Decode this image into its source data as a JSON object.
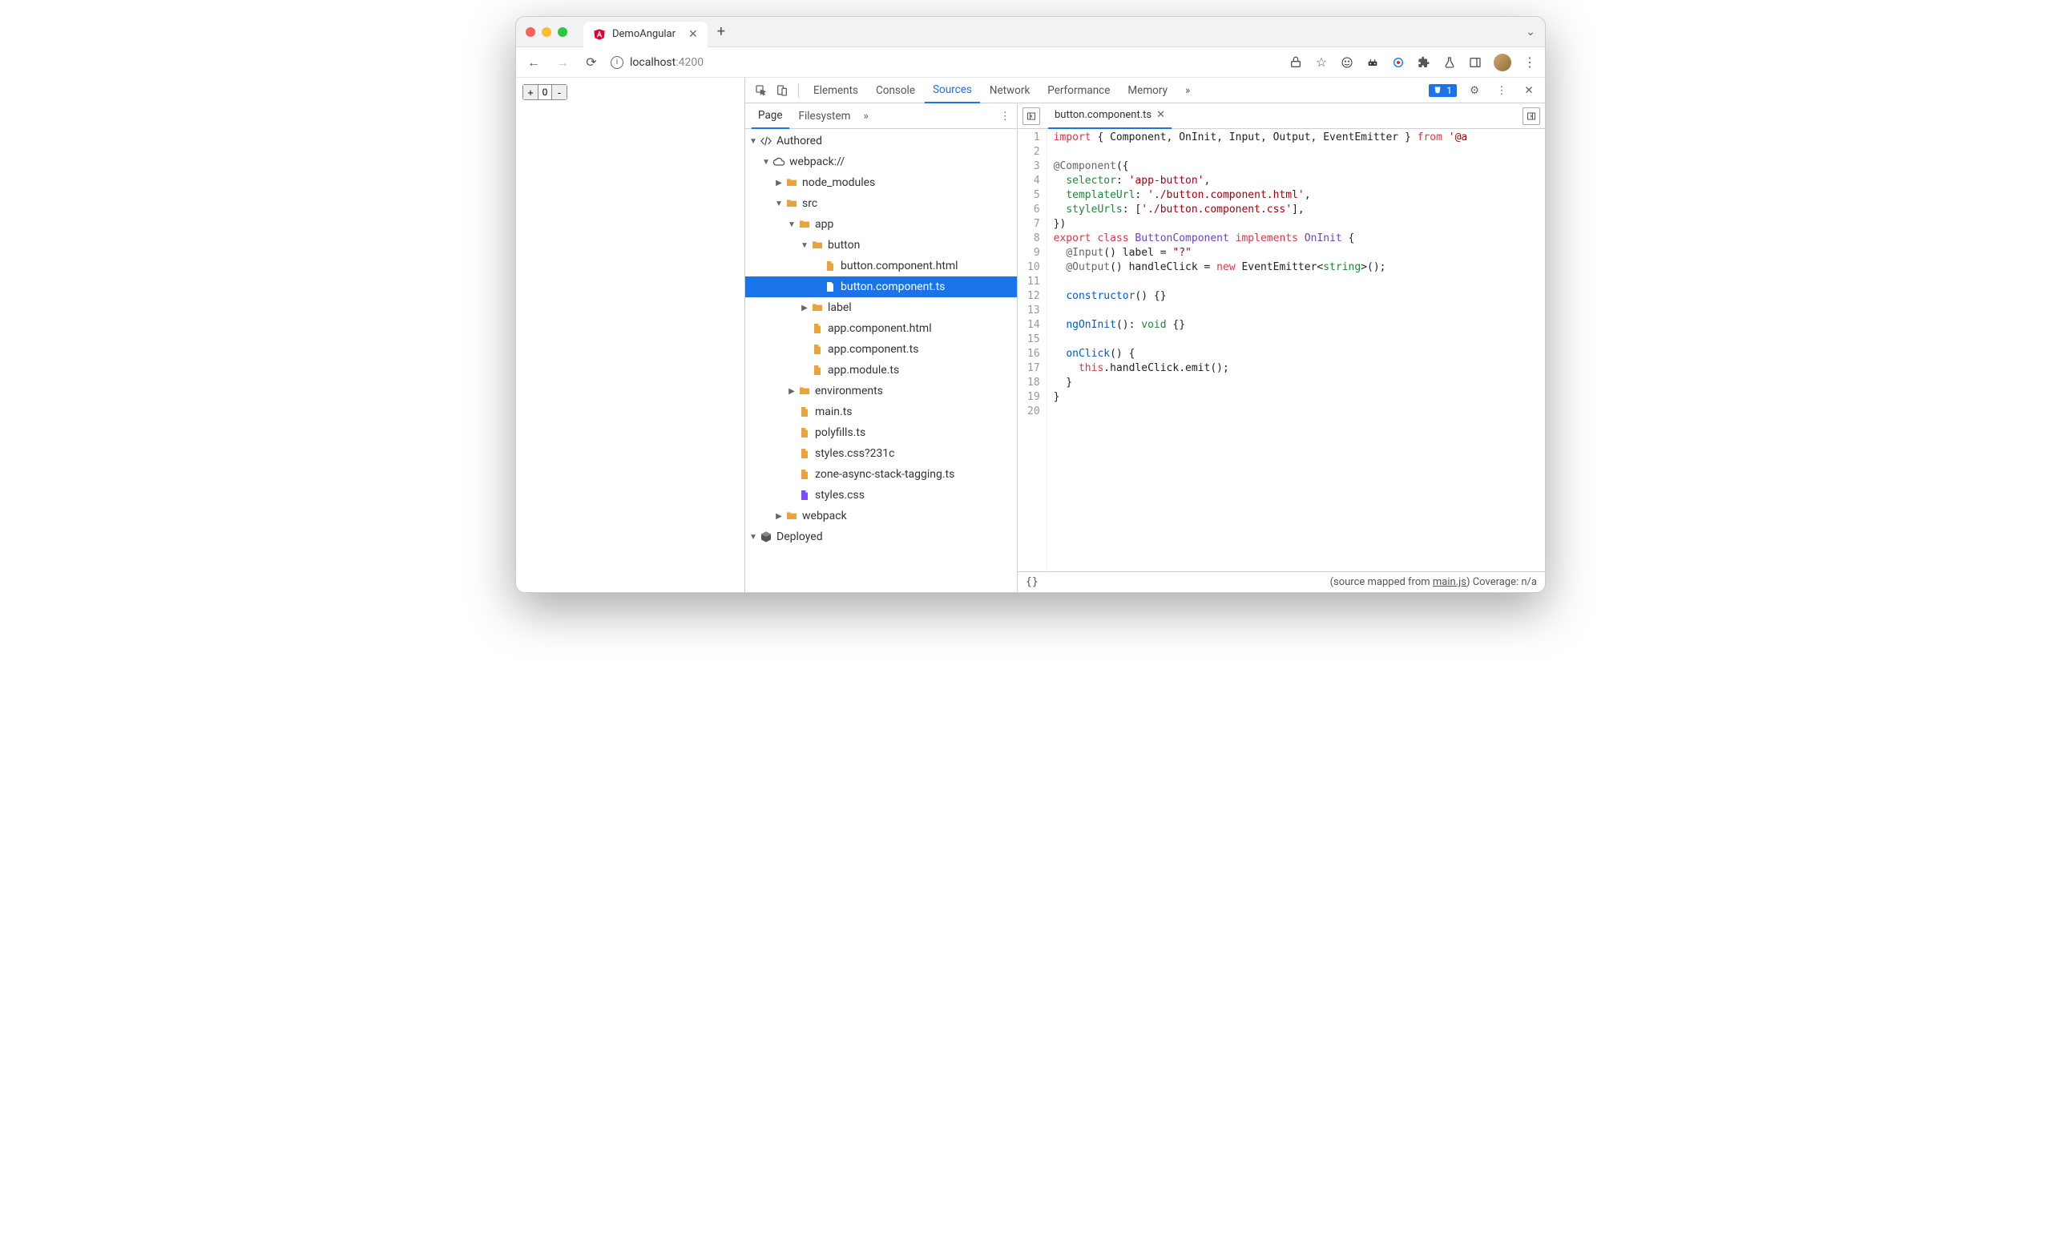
{
  "browser": {
    "tab_title": "DemoAngular",
    "url_host": "localhost",
    "url_port": ":4200"
  },
  "page_app": {
    "counter_value": "0",
    "plus": "+",
    "minus": "-"
  },
  "devtools": {
    "tabs": [
      "Elements",
      "Console",
      "Sources",
      "Network",
      "Performance",
      "Memory"
    ],
    "active_tab": "Sources",
    "issues_count": "1"
  },
  "sources_nav": {
    "tabs": [
      "Page",
      "Filesystem"
    ],
    "active": "Page"
  },
  "tree": {
    "authored": "Authored",
    "webpack": "webpack://",
    "node_modules": "node_modules",
    "src": "src",
    "app": "app",
    "button": "button",
    "button_html": "button.component.html",
    "button_ts": "button.component.ts",
    "label": "label",
    "app_html": "app.component.html",
    "app_ts": "app.component.ts",
    "app_module": "app.module.ts",
    "environments": "environments",
    "main_ts": "main.ts",
    "polyfills": "polyfills.ts",
    "styles_q": "styles.css?231c",
    "zone": "zone-async-stack-tagging.ts",
    "styles": "styles.css",
    "webpack_folder": "webpack",
    "deployed": "Deployed"
  },
  "editor": {
    "open_file": "button.component.ts",
    "lines": [
      {
        "n": 1,
        "seg": [
          [
            "red",
            "import"
          ],
          [
            "",
            " { Component, OnInit, Input, Output, EventEmitter } "
          ],
          [
            "red",
            "from"
          ],
          [
            "",
            " "
          ],
          [
            "darkred",
            "'@a"
          ]
        ]
      },
      {
        "n": 2,
        "seg": [
          [
            "",
            ""
          ]
        ]
      },
      {
        "n": 3,
        "seg": [
          [
            "at",
            "@Component"
          ],
          [
            "",
            "({"
          ]
        ]
      },
      {
        "n": 4,
        "seg": [
          [
            "",
            "  "
          ],
          [
            "green",
            "selector"
          ],
          [
            "",
            ": "
          ],
          [
            "darkred",
            "'app-button'"
          ],
          [
            "",
            ","
          ]
        ]
      },
      {
        "n": 5,
        "seg": [
          [
            "",
            "  "
          ],
          [
            "green",
            "templateUrl"
          ],
          [
            "",
            ": "
          ],
          [
            "darkred",
            "'./button.component.html'"
          ],
          [
            "",
            ","
          ]
        ]
      },
      {
        "n": 6,
        "seg": [
          [
            "",
            "  "
          ],
          [
            "green",
            "styleUrls"
          ],
          [
            "",
            ": ["
          ],
          [
            "darkred",
            "'./button.component.css'"
          ],
          [
            "",
            "],"
          ]
        ]
      },
      {
        "n": 7,
        "seg": [
          [
            "",
            "})"
          ]
        ]
      },
      {
        "n": 8,
        "seg": [
          [
            "red",
            "export"
          ],
          [
            "",
            " "
          ],
          [
            "red",
            "class"
          ],
          [
            "",
            " "
          ],
          [
            "purple",
            "ButtonComponent"
          ],
          [
            "",
            " "
          ],
          [
            "red",
            "implements"
          ],
          [
            "",
            " "
          ],
          [
            "purple",
            "OnInit"
          ],
          [
            "",
            " {"
          ]
        ]
      },
      {
        "n": 9,
        "seg": [
          [
            "",
            "  "
          ],
          [
            "at",
            "@Input"
          ],
          [
            "",
            "() label = "
          ],
          [
            "darkred",
            "\"?\""
          ]
        ]
      },
      {
        "n": 10,
        "seg": [
          [
            "",
            "  "
          ],
          [
            "at",
            "@Output"
          ],
          [
            "",
            "() handleClick = "
          ],
          [
            "red",
            "new"
          ],
          [
            "",
            " EventEmitter<"
          ],
          [
            "green",
            "string"
          ],
          [
            "",
            ">();"
          ]
        ]
      },
      {
        "n": 11,
        "seg": [
          [
            "",
            ""
          ]
        ]
      },
      {
        "n": 12,
        "seg": [
          [
            "",
            "  "
          ],
          [
            "blue",
            "constructor"
          ],
          [
            "",
            "() {}"
          ]
        ]
      },
      {
        "n": 13,
        "seg": [
          [
            "",
            ""
          ]
        ]
      },
      {
        "n": 14,
        "seg": [
          [
            "",
            "  "
          ],
          [
            "blue",
            "ngOnInit"
          ],
          [
            "",
            "(): "
          ],
          [
            "green",
            "void"
          ],
          [
            "",
            " {}"
          ]
        ]
      },
      {
        "n": 15,
        "seg": [
          [
            "",
            ""
          ]
        ]
      },
      {
        "n": 16,
        "seg": [
          [
            "",
            "  "
          ],
          [
            "blue",
            "onClick"
          ],
          [
            "",
            "() {"
          ]
        ]
      },
      {
        "n": 17,
        "seg": [
          [
            "",
            "    "
          ],
          [
            "red",
            "this"
          ],
          [
            "",
            ".handleClick.emit();"
          ]
        ]
      },
      {
        "n": 18,
        "seg": [
          [
            "",
            "  }"
          ]
        ]
      },
      {
        "n": 19,
        "seg": [
          [
            "",
            "}"
          ]
        ]
      },
      {
        "n": 20,
        "seg": [
          [
            "",
            ""
          ]
        ]
      }
    ]
  },
  "statusbar": {
    "curly": "{}",
    "mapped_prefix": "(source mapped from ",
    "mapped_link": "main.js",
    "mapped_suffix": ")",
    "coverage": "  Coverage: n/a"
  }
}
